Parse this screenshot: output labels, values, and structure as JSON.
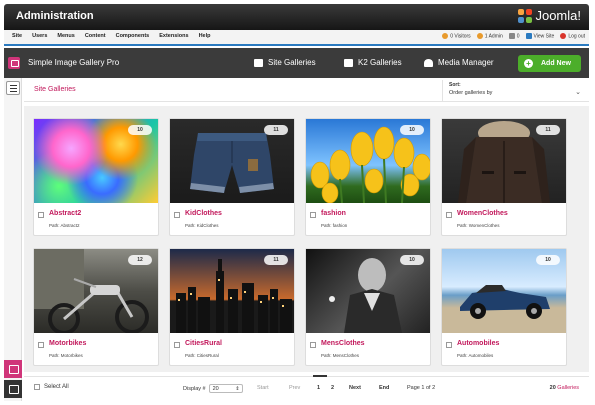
{
  "app": {
    "title": "Administration",
    "brand": "Joomla!"
  },
  "menubar": {
    "items": [
      "Site",
      "Users",
      "Menus",
      "Content",
      "Components",
      "Extensions",
      "Help"
    ],
    "visitors": "0 Visitors",
    "admins": "1 Admin",
    "messages": "0",
    "view_site": "View Site",
    "logout": "Log out"
  },
  "toolbar": {
    "component_title": "Simple Image Gallery Pro",
    "site_galleries": "Site Galleries",
    "k2_galleries": "K2 Galleries",
    "media_manager": "Media Manager",
    "add_new": "Add New",
    "add_color": "#4cae2a"
  },
  "heading": {
    "title": "Site Galleries",
    "sort_label": "Sort:",
    "sort_value": "Order galleries by"
  },
  "galleries": [
    {
      "name": "Abstract2",
      "path": "Path: Abstract2",
      "count": "10",
      "thumb": "abstract-color-blur"
    },
    {
      "name": "KidClothes",
      "path": "Path: KidClothes",
      "count": "11",
      "thumb": "denim-shorts"
    },
    {
      "name": "fashion",
      "path": "Path: fashion",
      "count": "10",
      "thumb": "yellow-tulips"
    },
    {
      "name": "WomenClothes",
      "path": "Path: WomenClothes",
      "count": "11",
      "thumb": "fur-jacket"
    },
    {
      "name": "Motorbikes",
      "path": "Path: Motorbikes",
      "count": "12",
      "thumb": "motorcycle"
    },
    {
      "name": "CitiesRural",
      "path": "Path: CitiesRural",
      "count": "11",
      "thumb": "city-skyline-night"
    },
    {
      "name": "MensClothes",
      "path": "Path: MensClothes",
      "count": "10",
      "thumb": "man-portrait-bw"
    },
    {
      "name": "Automobiles",
      "path": "Path: Automobiles",
      "count": "10",
      "thumb": "blue-convertible"
    }
  ],
  "footer": {
    "select_all": "Select All",
    "display_label": "Display #",
    "display_value": "20",
    "start": "Start",
    "prev": "Prev",
    "page1": "1",
    "page2": "2",
    "next": "Next",
    "end": "End",
    "page_of": "Page 1 of 2",
    "total_count": "20",
    "total_label": "Galleries"
  },
  "colors": {
    "accent": "#c2185b",
    "header_bg": "#1e1e1e",
    "toolbar_bg": "#3b3b3b",
    "menubar_border": "#2a7ac0"
  }
}
